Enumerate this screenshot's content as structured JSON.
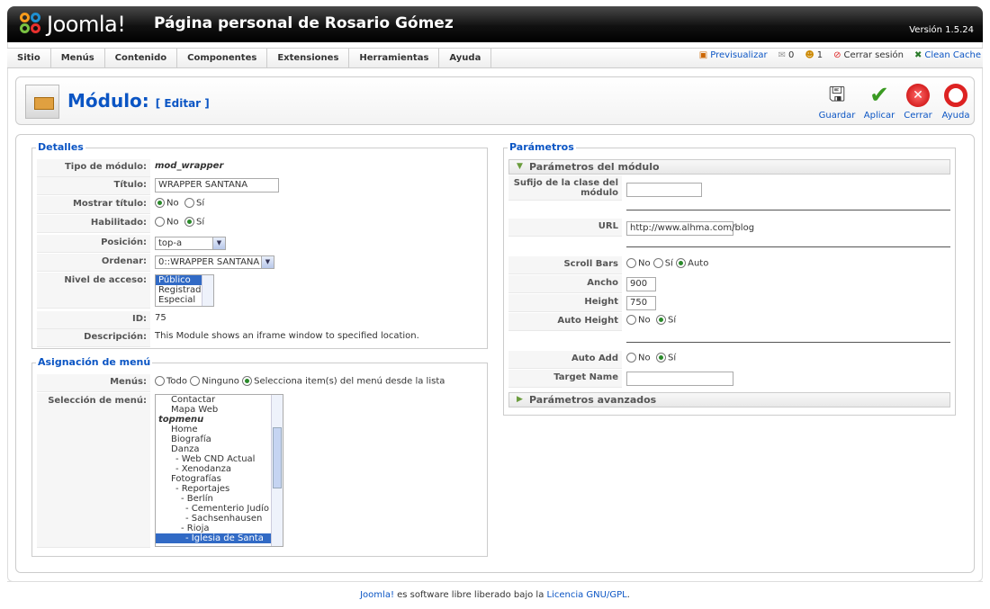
{
  "header": {
    "logo_text": "Joomla!",
    "site_title": "Página personal de Rosario Gómez",
    "version": "Versión 1.5.24"
  },
  "menu": [
    "Sitio",
    "Menús",
    "Contenido",
    "Componentes",
    "Extensiones",
    "Herramientas",
    "Ayuda"
  ],
  "status": {
    "preview": "Previsualizar",
    "messages": "0",
    "users": "1",
    "logout": "Cerrar sesión",
    "clean_cache": "Clean Cache"
  },
  "toolbar": {
    "title": "Módulo:",
    "subtitle": "[ Editar ]",
    "save": "Guardar",
    "apply": "Aplicar",
    "close": "Cerrar",
    "help": "Ayuda"
  },
  "details": {
    "legend": "Detalles",
    "type_label": "Tipo de módulo:",
    "type_value": "mod_wrapper",
    "title_label": "Título:",
    "title_value": "WRAPPER SANTANA",
    "show_title_label": "Mostrar título:",
    "no": "No",
    "si": "Sí",
    "enabled_label": "Habilitado:",
    "position_label": "Posición:",
    "position_value": "top-a",
    "order_label": "Ordenar:",
    "order_value": "0::WRAPPER SANTANA",
    "access_label": "Nivel de acceso:",
    "access_options": [
      "Público",
      "Registrado",
      "Especial"
    ],
    "id_label": "ID:",
    "id_value": "75",
    "desc_label": "Descripción:",
    "desc_value": "This Module shows an iframe window to specified location."
  },
  "menu_assign": {
    "legend": "Asignación de menú",
    "menus_label": "Menús:",
    "opt_all": "Todo",
    "opt_none": "Ninguno",
    "opt_select": "Selecciona item(s) del menú desde la lista",
    "selection_label": "Selección de menú:",
    "items": [
      "Contactar",
      "Mapa Web",
      "topmenu",
      "Home",
      "Biografía",
      "Danza",
      "- Web CND Actual",
      "- Xenodanza",
      "Fotografías",
      "- Reportajes",
      "- Berlín",
      "- Cementerio Judío",
      "- Sachsenhausen",
      "- Rioja",
      "- Iglesia de Santa Ana"
    ]
  },
  "params": {
    "legend": "Parámetros",
    "module_params": "Parámetros del módulo",
    "suffix_label_1": "Sufijo de la clase del",
    "suffix_label_2": "módulo",
    "url_label": "URL",
    "url_value": "http://www.alhma.com/blog",
    "scroll_label": "Scroll Bars",
    "auto": "Auto",
    "width_label": "Ancho",
    "width_value": "900",
    "height_label": "Height",
    "height_value": "750",
    "auto_height_label": "Auto Height",
    "auto_add_label": "Auto Add",
    "target_label": "Target Name",
    "advanced": "Parámetros avanzados"
  },
  "footer": {
    "joomla": "Joomla!",
    "text": " es software libre liberado bajo la ",
    "license": "Licencia GNU/GPL",
    "dot": "."
  }
}
